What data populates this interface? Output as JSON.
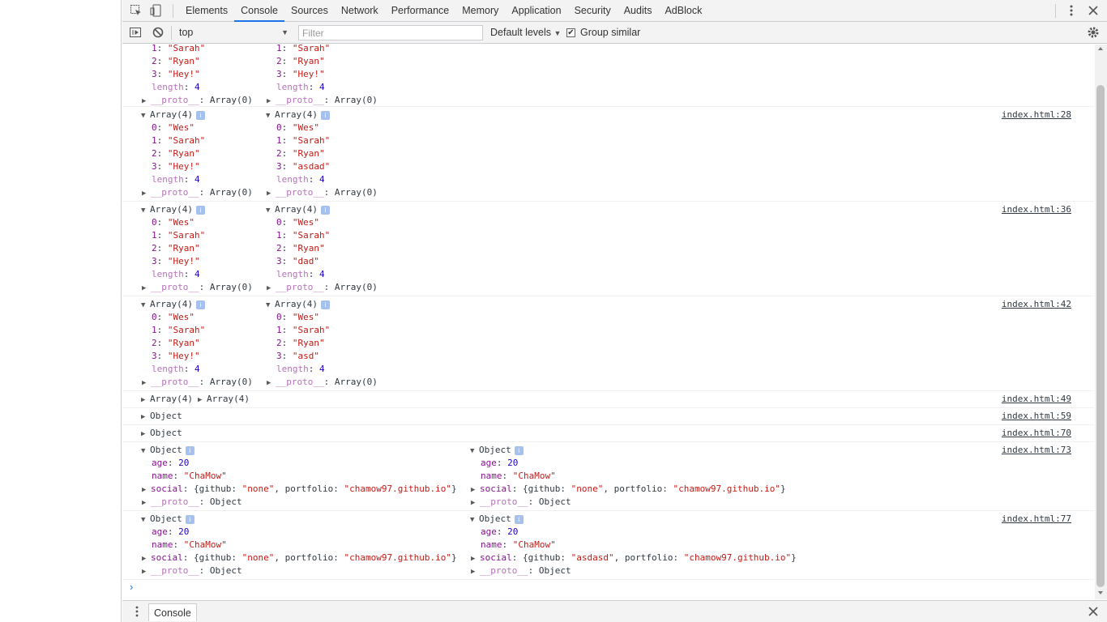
{
  "tabs": [
    "Elements",
    "Console",
    "Sources",
    "Network",
    "Performance",
    "Memory",
    "Application",
    "Security",
    "Audits",
    "AdBlock"
  ],
  "active_tab": "Console",
  "toolbar": {
    "context": "top",
    "filter_placeholder": "Filter",
    "levels": "Default levels",
    "group_similar": "Group similar"
  },
  "messages": {
    "m0": {
      "l": [
        "1: \"Sarah\"",
        "2: \"Ryan\"",
        "3: \"Hey!\"",
        "length: 4",
        "__proto__: Array(0)"
      ],
      "r": [
        "1: \"Sarah\"",
        "2: \"Ryan\"",
        "3: \"Hey!\"",
        "length: 4",
        "__proto__: Array(0)"
      ]
    },
    "m1": {
      "link": "index.html:28",
      "l_head": "Array(4)",
      "r_head": "Array(4)",
      "l": [
        "0: \"Wes\"",
        "1: \"Sarah\"",
        "2: \"Ryan\"",
        "3: \"Hey!\"",
        "length: 4",
        "__proto__: Array(0)"
      ],
      "r": [
        "0: \"Wes\"",
        "1: \"Sarah\"",
        "2: \"Ryan\"",
        "3: \"asdad\"",
        "length: 4",
        "__proto__: Array(0)"
      ]
    },
    "m2": {
      "link": "index.html:36",
      "l_head": "Array(4)",
      "r_head": "Array(4)",
      "l": [
        "0: \"Wes\"",
        "1: \"Sarah\"",
        "2: \"Ryan\"",
        "3: \"Hey!\"",
        "length: 4",
        "__proto__: Array(0)"
      ],
      "r": [
        "0: \"Wes\"",
        "1: \"Sarah\"",
        "2: \"Ryan\"",
        "3: \"dad\"",
        "length: 4",
        "__proto__: Array(0)"
      ]
    },
    "m3": {
      "link": "index.html:42",
      "l_head": "Array(4)",
      "r_head": "Array(4)",
      "l": [
        "0: \"Wes\"",
        "1: \"Sarah\"",
        "2: \"Ryan\"",
        "3: \"Hey!\"",
        "length: 4",
        "__proto__: Array(0)"
      ],
      "r": [
        "0: \"Wes\"",
        "1: \"Sarah\"",
        "2: \"Ryan\"",
        "3: \"asd\"",
        "length: 4",
        "__proto__: Array(0)"
      ]
    },
    "m4": {
      "link": "index.html:49",
      "l_head": "Array(4)",
      "r_head": "Array(4)"
    },
    "m5": {
      "link": "index.html:59",
      "head": "Object"
    },
    "m6": {
      "link": "index.html:70",
      "head": "Object"
    },
    "m7": {
      "link": "index.html:73",
      "l_head": "Object",
      "r_head": "Object",
      "l": [
        "age: 20",
        "name: \"ChaMow\"",
        "social: {github: \"none\", portfolio: \"chamow97.github.io\"}",
        "__proto__: Object"
      ],
      "r": [
        "age: 20",
        "name: \"ChaMow\"",
        "social: {github: \"none\", portfolio: \"chamow97.github.io\"}",
        "__proto__: Object"
      ]
    },
    "m8": {
      "link": "index.html:77",
      "l_head": "Object",
      "r_head": "Object",
      "l": [
        "age: 20",
        "name: \"ChaMow\"",
        "social: {github: \"none\", portfolio: \"chamow97.github.io\"}",
        "__proto__: Object"
      ],
      "r": [
        "age: 20",
        "name: \"ChaMow\"",
        "social: {github: \"asdasd\", portfolio: \"chamow97.github.io\"}",
        "__proto__: Object"
      ]
    }
  },
  "prompt": "›",
  "drawer_tab": "Console"
}
